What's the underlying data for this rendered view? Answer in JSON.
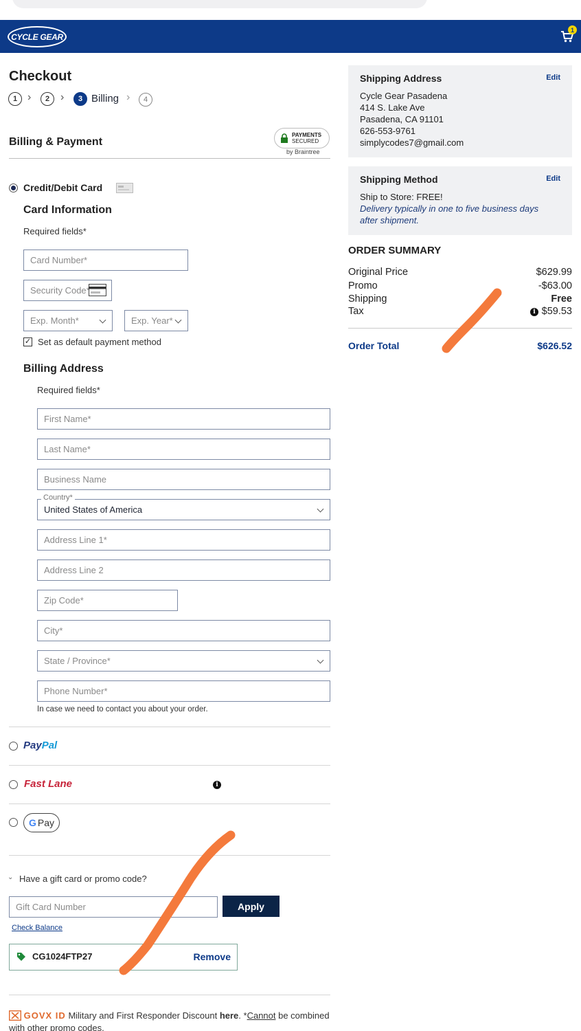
{
  "header": {
    "logo_text": "CYCLE GEAR",
    "cart_count": "1"
  },
  "page_title": "Checkout",
  "steps": [
    {
      "num": "1"
    },
    {
      "num": "2"
    },
    {
      "num": "3",
      "label": "Billing"
    },
    {
      "num": "4"
    }
  ],
  "billing": {
    "heading": "Billing & Payment",
    "secured_line1": "PAYMENTS",
    "secured_line2": "SECURED",
    "braintree": "by Braintree",
    "card_option": "Credit/Debit Card",
    "card_info_heading": "Card Information",
    "required_fields": "Required fields*",
    "card_number_placeholder": "Card Number*",
    "security_code_placeholder": "Security Code*",
    "exp_month_placeholder": "Exp. Month*",
    "exp_year_placeholder": "Exp. Year*",
    "default_payment_label": "Set as default payment method",
    "default_payment_checked": true
  },
  "billing_address": {
    "heading": "Billing Address",
    "required_fields": "Required fields*",
    "first_name": "First Name*",
    "last_name": "Last Name*",
    "business_name": "Business Name",
    "country_label": "Country*",
    "country_value": "United States of America",
    "address1": "Address Line 1*",
    "address2": "Address Line 2",
    "zip": "Zip Code*",
    "city": "City*",
    "state": "State / Province*",
    "phone": "Phone Number*",
    "phone_help": "In case we need to contact you about your order."
  },
  "payment_options": {
    "paypal_1": "Pay",
    "paypal_2": "Pal",
    "fastlane": "Fast Lane",
    "gpay_g": "G",
    "gpay_text": "Pay"
  },
  "promo": {
    "toggle": "Have a gift card or promo code?",
    "gift_card_placeholder": "Gift Card Number",
    "apply": "Apply",
    "check_balance": "Check Balance",
    "applied_code": "CG1024FTP27",
    "remove": "Remove"
  },
  "govx": {
    "brand": "GOVX ID",
    "text": "Military and First Responder Discount",
    "here": "here",
    "rest1": ". *",
    "cannot": "Cannot",
    "rest2": " be combined with other promo codes."
  },
  "shipping_address": {
    "heading": "Shipping Address",
    "edit": "Edit",
    "lines": [
      "Cycle Gear Pasadena",
      "414 S. Lake Ave",
      "Pasadena, CA 91101",
      "626-553-9761",
      "simplycodes7@gmail.com"
    ]
  },
  "shipping_method": {
    "heading": "Shipping Method",
    "edit": "Edit",
    "line": "Ship to Store: FREE!",
    "note1": "Delivery typically in one to five business days",
    "note2": "after shipment."
  },
  "order_summary": {
    "heading": "ORDER SUMMARY",
    "rows": [
      {
        "label": "Original Price",
        "value": "$629.99"
      },
      {
        "label": "Promo",
        "value": "-$63.00"
      },
      {
        "label": "Shipping",
        "value": "Free"
      },
      {
        "label": "Tax",
        "value": "$59.53"
      }
    ],
    "total_label": "Order Total",
    "total_value": "$626.52"
  },
  "colors": {
    "brand_blue": "#0d3a88",
    "annotation_orange": "#f47a3c"
  }
}
